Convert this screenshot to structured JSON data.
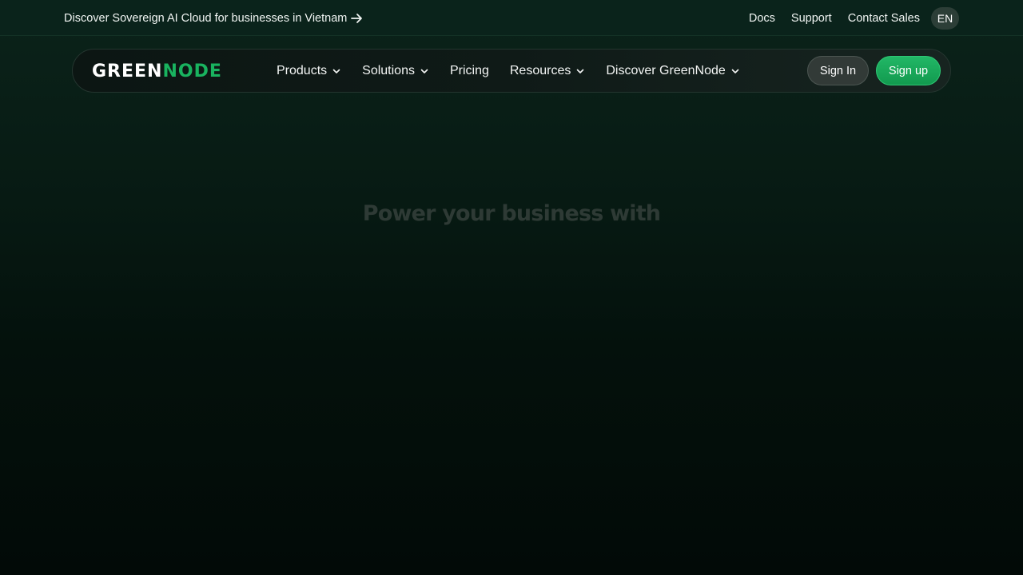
{
  "announcement": {
    "text": "Discover Sovereign AI Cloud for businesses in Vietnam",
    "icon": "arrow-right-icon"
  },
  "top_links": [
    "Docs",
    "Support",
    "Contact Sales"
  ],
  "language": "EN",
  "logo": {
    "part1": "GREEN",
    "part2": "NODE"
  },
  "nav": {
    "items": [
      {
        "label": "Products",
        "has_dropdown": true
      },
      {
        "label": "Solutions",
        "has_dropdown": true
      },
      {
        "label": "Pricing",
        "has_dropdown": false
      },
      {
        "label": "Resources",
        "has_dropdown": true
      },
      {
        "label": "Discover GreenNode",
        "has_dropdown": true
      }
    ],
    "sign_in": "Sign In",
    "sign_up": "Sign up"
  },
  "hero": {
    "title": "Power your business with"
  },
  "colors": {
    "accent": "#19b35f",
    "topbar_bg": "#0a231b",
    "page_bg_top": "#0b231a",
    "page_bg_bottom": "#020a07"
  }
}
